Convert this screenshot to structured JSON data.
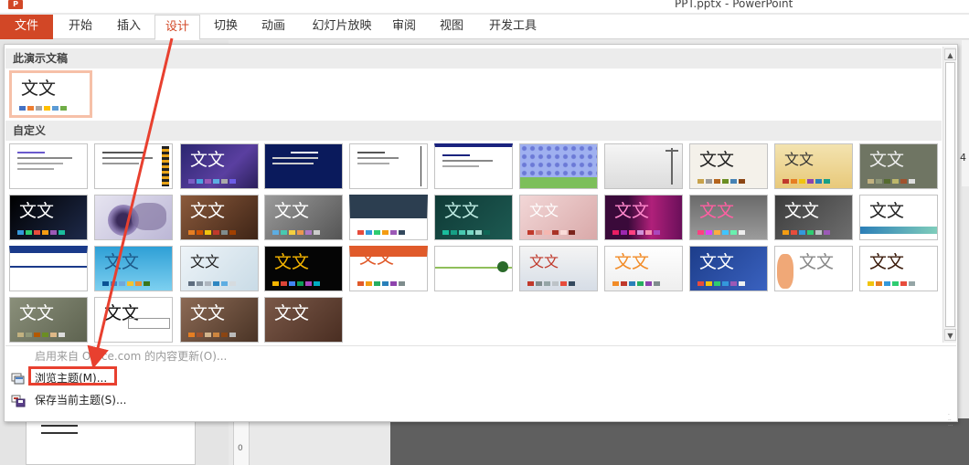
{
  "window": {
    "title": "PPT.pptx - PowerPoint",
    "app_icon_letter": "P"
  },
  "ribbon": {
    "tabs": [
      {
        "label": "文件"
      },
      {
        "label": "开始"
      },
      {
        "label": "插入"
      },
      {
        "label": "设计"
      },
      {
        "label": "切换"
      },
      {
        "label": "动画"
      },
      {
        "label": "幻灯片放映"
      },
      {
        "label": "审阅"
      },
      {
        "label": "视图"
      },
      {
        "label": "开发工具"
      }
    ],
    "active_tab": "设计"
  },
  "gallery": {
    "section_current": "此演示文稿",
    "section_custom": "自定义",
    "theme_text": "文文",
    "current_theme_text": "文文"
  },
  "menu": {
    "office_updates": "启用来自 Office.com 的内容更新(O)...",
    "browse_themes": "浏览主题(M)...",
    "save_theme": "保存当前主题(S)..."
  },
  "background": {
    "ruler_mark": "0",
    "right_panel_number": "4"
  },
  "colors": {
    "accent": "#d24726",
    "annotation": "#e8402f",
    "selection": "#f6c0a8"
  }
}
